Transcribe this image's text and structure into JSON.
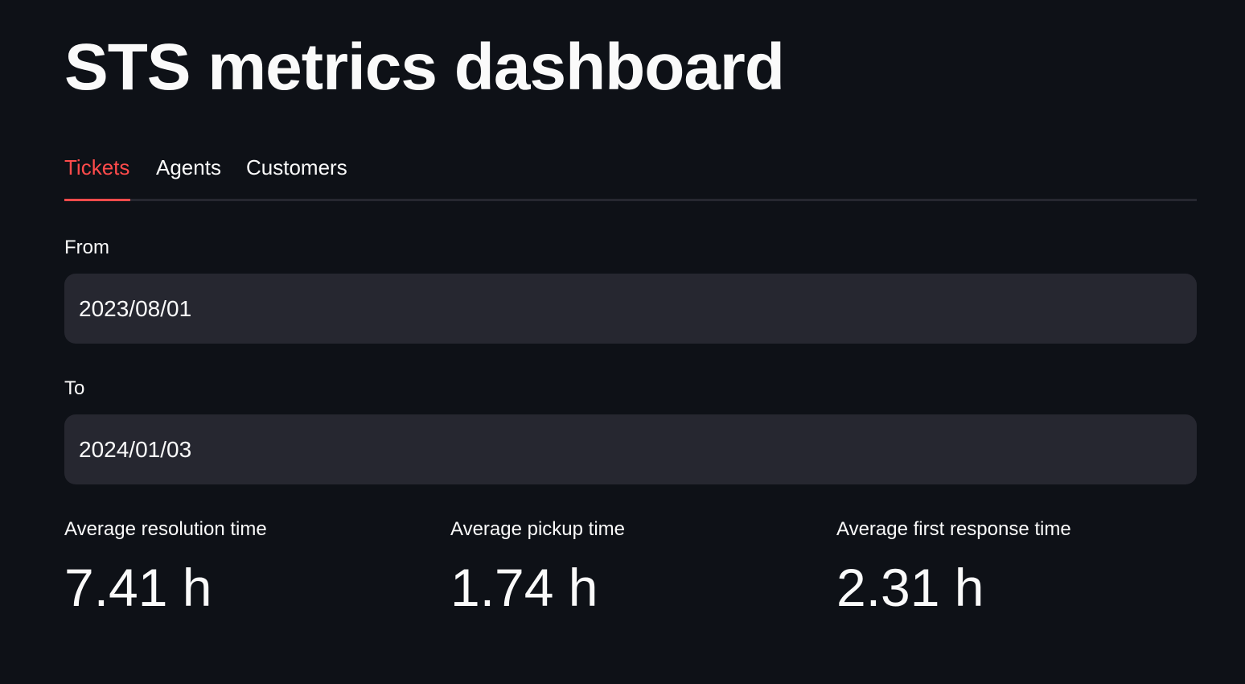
{
  "page": {
    "title": "STS metrics dashboard"
  },
  "tabs": [
    {
      "label": "Tickets",
      "active": true
    },
    {
      "label": "Agents",
      "active": false
    },
    {
      "label": "Customers",
      "active": false
    }
  ],
  "filters": {
    "from": {
      "label": "From",
      "value": "2023/08/01"
    },
    "to": {
      "label": "To",
      "value": "2024/01/03"
    }
  },
  "metrics": [
    {
      "label": "Average resolution time",
      "value": "7.41 h"
    },
    {
      "label": "Average pickup time",
      "value": "1.74 h"
    },
    {
      "label": "Average first response time",
      "value": "2.31 h"
    }
  ],
  "colors": {
    "background": "#0e1117",
    "accent": "#ff4b4b",
    "input_background": "#262730",
    "text": "#fafafa"
  }
}
